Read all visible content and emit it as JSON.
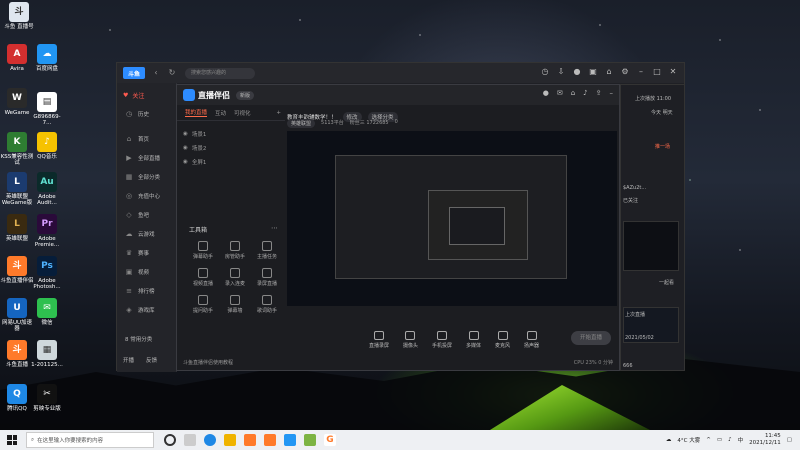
{
  "desktop": {
    "icons": [
      {
        "label": "斗鱼 直播号",
        "icon": "douyu-icon",
        "color": "#dfe6ef"
      },
      {
        "label": "Avira",
        "icon": "avira-icon",
        "color": "#d32f2f"
      },
      {
        "label": "百度网盘",
        "icon": "baidu-netdisk-icon",
        "color": "#2196f3"
      },
      {
        "label": "WeGame",
        "icon": "wegame-icon",
        "color": "#2a2a2a"
      },
      {
        "label": "G896869-7...",
        "icon": "file-icon",
        "color": "#ffffff"
      },
      {
        "label": "KSS兼容性测试",
        "icon": "kss-icon",
        "color": "#2e7d32"
      },
      {
        "label": "QQ音乐",
        "icon": "qq-music-icon",
        "color": "#f6c200"
      },
      {
        "label": "英雄联盟 WeGame版",
        "icon": "lol-wegame-icon",
        "color": "#1b3b6f"
      },
      {
        "label": "Adobe Audit...",
        "icon": "adobe-audition-icon",
        "color": "#0b2a2a"
      },
      {
        "label": "英雄联盟",
        "icon": "lol-icon",
        "color": "#3a2a10"
      },
      {
        "label": "Adobe Premie...",
        "icon": "adobe-premiere-icon",
        "color": "#2a0a3a"
      },
      {
        "label": "斗鱼直播伴侣",
        "icon": "douyu-companion-icon",
        "color": "#ff7a2a"
      },
      {
        "label": "Adobe Photosh...",
        "icon": "adobe-photoshop-icon",
        "color": "#061d3a"
      },
      {
        "label": "网易UU加速器",
        "icon": "uu-accelerator-icon",
        "color": "#1565c0"
      },
      {
        "label": "微信",
        "icon": "wechat-icon",
        "color": "#2ec04f"
      },
      {
        "label": "斗鱼直播",
        "icon": "douyu-live-icon",
        "color": "#ff7a2a"
      },
      {
        "label": "1-201125...",
        "icon": "image-file-icon",
        "color": "#cfd8dc"
      },
      {
        "label": "腾讯QQ",
        "icon": "qq-icon",
        "color": "#1e88e5"
      },
      {
        "label": "剪映专业版",
        "icon": "capcut-icon",
        "color": "#111111"
      }
    ]
  },
  "app": {
    "title_search": "搜索您感兴趣的",
    "follow_label": "关注",
    "sidebar": [
      {
        "label": "历史",
        "icon": "history-icon"
      },
      {
        "label": "首页",
        "icon": "home-icon"
      },
      {
        "label": "全部直播",
        "icon": "live-icon"
      },
      {
        "label": "全部分类",
        "icon": "category-icon"
      },
      {
        "label": "充值中心",
        "icon": "recharge-icon"
      },
      {
        "label": "鱼吧",
        "icon": "fish-bar-icon"
      },
      {
        "label": "云游戏",
        "icon": "cloud-game-icon"
      },
      {
        "label": "赛事",
        "icon": "trophy-icon"
      },
      {
        "label": "视频",
        "icon": "video-icon"
      },
      {
        "label": "排行榜",
        "icon": "rank-icon"
      },
      {
        "label": "游戏库",
        "icon": "game-lib-icon"
      }
    ],
    "sidebar_bottom": [
      "开播",
      "反馈"
    ],
    "sidebar_extra": "8 常用分类"
  },
  "stream": {
    "title": "直播伴侣",
    "version": "新版",
    "room_title": "教育丰韵辅数学！！",
    "edit_label": "修改",
    "category": "选择分类",
    "room_id_label": "英雄联盟",
    "room_id": "5113平台",
    "stats": "粉丝三 1722685",
    "stats2": "0",
    "tabs": [
      "我的直播",
      "互动",
      "可视化"
    ],
    "scenes": [
      "场景1",
      "场景2",
      "全屏1"
    ],
    "tools_title": "工具箱",
    "tools": [
      "弹幕助手",
      "房管助手",
      "主播任务",
      "视频直播",
      "录入连麦",
      "录屏直播",
      "提问助手",
      "弹幕墙",
      "歌词助手"
    ],
    "bottom_actions": [
      "直播录屏",
      "摄像头",
      "手机投屏",
      "多媒体",
      "麦克风",
      "扬声器"
    ],
    "start_live": "开始直播",
    "footer_hint": "斗鱼直播伴侣使用教程",
    "fps_text": "CPU 23% 0 分钟"
  },
  "right_panel": {
    "time": "上次播放 11:00",
    "tag": "今天 明天",
    "badge": "推一场",
    "streamer": "$AZu2t...",
    "note": "已关注",
    "count": "一起看",
    "label1": "上次直播",
    "label2": "2021/05/02",
    "num": "666"
  },
  "taskbar": {
    "search_placeholder": "在这里输入你要搜索的内容",
    "weather": "4°C 大雾",
    "ime": "中",
    "time": "11:45",
    "date": "2021/12/11"
  }
}
